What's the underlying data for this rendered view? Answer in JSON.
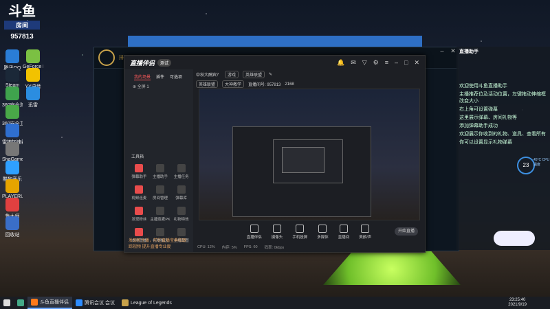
{
  "desktop": {
    "logo_big": "斗鱼",
    "logo_sub": "房间",
    "logo_num": "957813",
    "icons": [
      {
        "label": "腾讯QQ",
        "name": "qq-desktop-icon"
      },
      {
        "label": "GeForce Experience",
        "name": "geforce-desktop-icon"
      },
      {
        "label": "Steam",
        "name": "steam-desktop-icon"
      },
      {
        "label": "YY语音",
        "name": "yy-desktop-icon"
      },
      {
        "label": "360安全浏览器",
        "name": "browser-360-desktop-icon"
      },
      {
        "label": "迅雷",
        "name": "thunder-desktop-icon"
      },
      {
        "label": "360安全卫士",
        "name": "security-360-desktop-icon"
      },
      {
        "label": "雷神加速器",
        "name": "leishen-desktop-icon"
      },
      {
        "label": "ShaGame",
        "name": "shagame-desktop-icon"
      },
      {
        "label": "酷狗音乐",
        "name": "kugou-desktop-icon"
      },
      {
        "label": "PLAYERUNKNOWN'S BATTLEGR...",
        "name": "pubg-desktop-icon"
      },
      {
        "label": "鲁大师",
        "name": "ludashi-desktop-icon"
      },
      {
        "label": "回收站",
        "name": "recycle-bin-desktop-icon"
      }
    ]
  },
  "lol_window": {
    "title_left": "排位赛"
  },
  "right_panel": {
    "title": "直播助手",
    "lines": [
      "欢迎使用斗鱼直播助手",
      "主播推荐位及活动位置，左键拖动伸缩框改变大小",
      "右上角可设置弹幕",
      "这里展示弹幕、房间礼物等",
      "添加弹幕助手成功",
      "欢迎展示你收到的礼物、道具、查看所有",
      "你可以设置显示礼物弹幕"
    ]
  },
  "app": {
    "brand": "直播伴侣",
    "badge": "测试",
    "top_icons": [
      "bell",
      "mail",
      "shirt",
      "settings",
      "menu",
      "minimize",
      "maximize",
      "close"
    ],
    "tabs": [
      "我的场景",
      "插件",
      "可选项"
    ],
    "active_tab": "我的场景",
    "scene_label": "全屏 1",
    "tools_title": "工具箱",
    "tools": [
      "弹幕助手",
      "主播助手",
      "主播任务",
      "视频连麦",
      "房间管理",
      "弹幕库",
      "发现粉丝",
      "主播连麦PK",
      "礼物特效",
      "本地直播",
      "礼物推送",
      "主播截图"
    ],
    "notice": "发现新主播，前往直播宝典和跟踪视频 提升直播专业度",
    "room_title": "中秋大酬宾？",
    "room_tag": "游戏",
    "room_category": "英雄联盟",
    "sub_row": [
      "英雄联盟",
      "大神教学",
      "直播间号: 957813",
      "2168"
    ],
    "bottom_tools": [
      "直播伴侣",
      "摄像头",
      "手机投屏",
      "多媒体",
      "直播间",
      "美颜/声"
    ],
    "go_live": "开始直播",
    "status": [
      "CPU: 12%",
      "内存: 5%",
      "FPS: 60",
      "码率: 0kbps"
    ]
  },
  "widget": {
    "value": "23",
    "unit": "%",
    "label": "45°C CPU温度"
  },
  "taskbar": {
    "items": [
      {
        "label": "斗鱼直播伴侣",
        "active": true
      },
      {
        "label": "腾讯会议 会议",
        "active": false
      },
      {
        "label": "League of Legends",
        "active": false
      }
    ],
    "time": "23:25:40",
    "date": "2021/9/19"
  }
}
